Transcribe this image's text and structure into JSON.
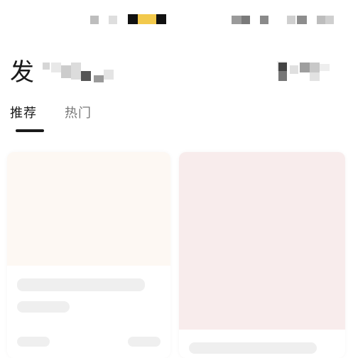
{
  "header": {
    "title_char": "发"
  },
  "tabs": [
    {
      "label": "推荐",
      "active": true
    },
    {
      "label": "热门",
      "active": false
    }
  ],
  "colors": {
    "accent": "#f2c94c",
    "text": "#1a1a1a",
    "inactive_tab": "#777777",
    "card_left_bg": "#fdf8f3",
    "card_right_bg": "#f8ecec",
    "skeleton": "#efefef"
  }
}
